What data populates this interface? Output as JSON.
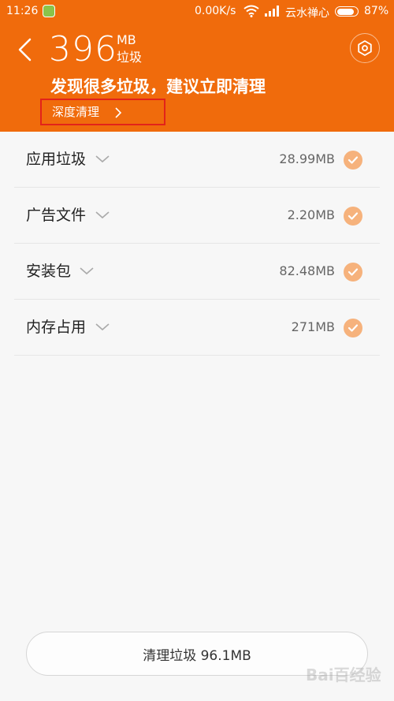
{
  "status_bar": {
    "time": "11:26",
    "network_speed": "0.00K/s",
    "carrier": "云水禅心",
    "battery_percent": "87%",
    "battery_level": 0.87
  },
  "header": {
    "junk_size": "396",
    "junk_unit": "MB",
    "junk_label": "垃圾",
    "suggestion": "发现很多垃圾，建议立即清理",
    "deep_clean_label": "深度清理",
    "background_color": "#f06b0c",
    "highlight_color": "#e2231a"
  },
  "categories": [
    {
      "label": "应用垃圾",
      "size": "28.99MB",
      "checked": true
    },
    {
      "label": "广告文件",
      "size": "2.20MB",
      "checked": true
    },
    {
      "label": "安装包",
      "size": "82.48MB",
      "checked": true
    },
    {
      "label": "内存占用",
      "size": "271MB",
      "checked": true
    }
  ],
  "check_color": "#f6b27c",
  "action_button": {
    "label": "清理垃圾 96.1MB"
  },
  "watermark": "Bai百经验"
}
